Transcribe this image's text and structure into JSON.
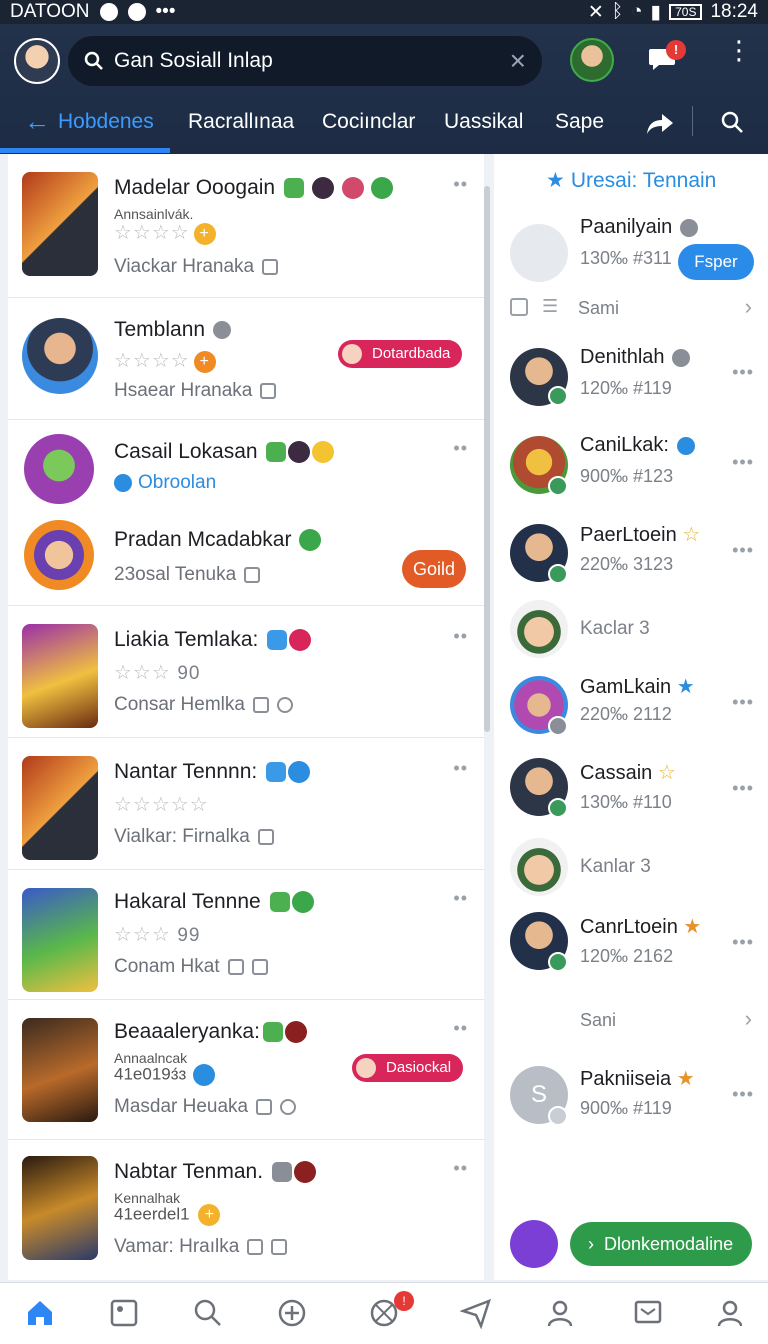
{
  "status": {
    "carrier": "DATOON",
    "time": "18:24",
    "battery": "70S"
  },
  "header": {
    "search_text": "Gan Sosiall Inlap",
    "chat_badge": "!",
    "tabs": [
      "Hobdenes",
      "Racrallınaa",
      "Cociınclar",
      "Uassikal",
      "Sape"
    ]
  },
  "left_items": [
    {
      "title": "Madelar Ooogain",
      "sub": "Annsainlvák.",
      "stars": "☆☆☆☆",
      "coin": "+",
      "meta": "Viackar Hranaka"
    },
    {
      "title": "Temblann",
      "stars": "☆☆☆☆",
      "coin": "+",
      "meta": "Hsaear Hranaka",
      "pill": "Dotardbada"
    },
    {
      "title": "Casail Lokasan",
      "link": "Obroolan"
    },
    {
      "title": "Pradan Mcadabkar",
      "meta": "23osal Tenuka",
      "gold": "Goild"
    },
    {
      "title": "Liakia Temlaka:",
      "stars": "☆☆☆",
      "stars_text": "90",
      "meta": "Consar Hemlka"
    },
    {
      "title": "Nantar Tennnn:",
      "stars": "☆☆☆☆☆",
      "meta": "Vialkar: Firnalka"
    },
    {
      "title": "Hakaral Tennne",
      "stars": "☆☆☆",
      "stars_text": "99",
      "meta": "Conam Hkat"
    },
    {
      "title": "Beaaaleryanka:",
      "sub": "Annaalncak",
      "sub2": "41e019ɜ́ɜ",
      "meta": "Masdar Heuaka",
      "pill": "Dasiockal"
    },
    {
      "title": "Nabtar Tenman.",
      "sub": "Kennalhak",
      "sub2": "41eerdel1",
      "coin": "+",
      "meta": "Vamar: Hraılka"
    }
  ],
  "right": {
    "heading": "Uresai: Tennain",
    "featured": {
      "name": "Paanilyain",
      "meta": "130‰ #311",
      "button": "Fsper"
    },
    "section_label": "Sami",
    "rows": [
      {
        "name": "Denithlah",
        "meta": "120‰ #119"
      },
      {
        "name": "CaniLkak:",
        "meta": "900‰ #123"
      },
      {
        "name": "PaerLtoein",
        "meta": "220‰ 3123"
      },
      {
        "name": "Kaclar 3",
        "meta": ""
      },
      {
        "name": "GamLkain",
        "meta": "220‰ 2112"
      },
      {
        "name": "Cassain",
        "meta": "130‰ #110"
      },
      {
        "name": "Kanlar 3",
        "meta": ""
      },
      {
        "name": "CanrLtoein",
        "meta": "120‰ 2162"
      }
    ],
    "section2_label": "Sani",
    "last": {
      "initial": "S",
      "name": "Pakniiseia",
      "meta": "900‰ #119"
    },
    "cta": "Dlonkemodaline"
  },
  "bottom_nav": {
    "badge": "!"
  },
  "colors": {
    "accent": "#2e86f5",
    "header_bg": "#22324a",
    "gold": "#e25a26",
    "cta": "#2e9b4a"
  }
}
